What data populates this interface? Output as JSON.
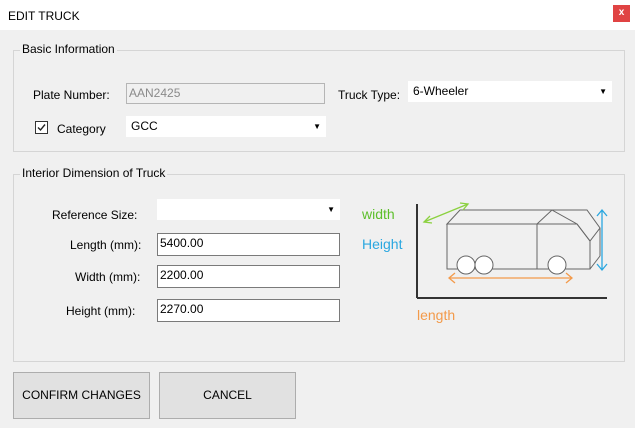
{
  "window": {
    "title": "EDIT TRUCK",
    "close_label": "x"
  },
  "basic_info": {
    "legend": "Basic Information",
    "plate_label": "Plate Number:",
    "plate_value": "AAN2425",
    "truck_type_label": "Truck Type:",
    "truck_type_value": "6-Wheeler",
    "category_label": "Category",
    "category_checked": true,
    "category_value": "GCC"
  },
  "interior": {
    "legend": "Interior Dimension of Truck",
    "reference_label": "Reference Size:",
    "reference_value": "",
    "length_label": "Length (mm):",
    "length_value": "5400.00",
    "width_label": "Width (mm):",
    "width_value": "2200.00",
    "height_label": "Height (mm):",
    "height_value": "2270.00"
  },
  "diagram": {
    "width_text": "width",
    "height_text": "Height",
    "length_text": "length",
    "width_color": "#5cbf2a",
    "height_color": "#2aa7e0",
    "length_color": "#f39a4a"
  },
  "buttons": {
    "confirm": "CONFIRM CHANGES",
    "cancel": "CANCEL"
  }
}
